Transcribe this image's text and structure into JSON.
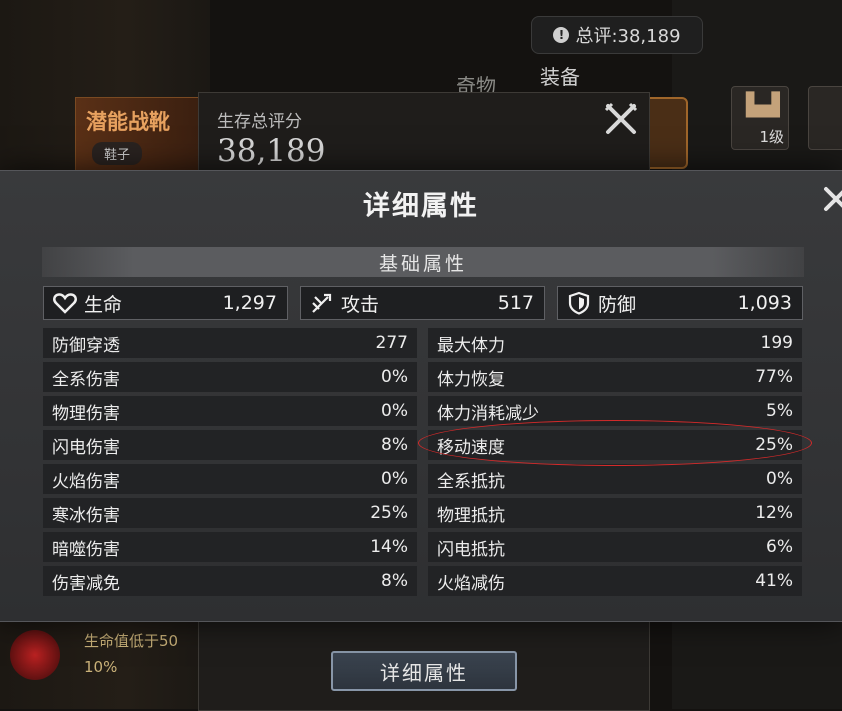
{
  "background": {
    "total_score_label": "总评:38,189",
    "tabs": {
      "curio": "奇物",
      "equipment": "装备"
    },
    "item": {
      "name": "潜能战靴",
      "type": "鞋子"
    },
    "slot_level": "1级",
    "panel": {
      "label": "生存总评分",
      "score": "38,189"
    },
    "bottom_text": [
      "生命值低于50",
      "10%"
    ],
    "bottom_button": "详细属性"
  },
  "modal": {
    "title": "详细属性",
    "section_title": "基础属性",
    "main_stats": [
      {
        "icon": "heart-icon",
        "label": "生命",
        "value": "1,297"
      },
      {
        "icon": "sword-icon",
        "label": "攻击",
        "value": "517"
      },
      {
        "icon": "shield-icon",
        "label": "防御",
        "value": "1,093"
      }
    ],
    "left_stats": [
      {
        "label": "防御穿透",
        "value": "277"
      },
      {
        "label": "全系伤害",
        "value": "0%"
      },
      {
        "label": "物理伤害",
        "value": "0%"
      },
      {
        "label": "闪电伤害",
        "value": "8%"
      },
      {
        "label": "火焰伤害",
        "value": "0%"
      },
      {
        "label": "寒冰伤害",
        "value": "25%"
      },
      {
        "label": "暗噬伤害",
        "value": "14%"
      },
      {
        "label": "伤害减免",
        "value": "8%"
      }
    ],
    "right_stats": [
      {
        "label": "最大体力",
        "value": "199"
      },
      {
        "label": "体力恢复",
        "value": "77%"
      },
      {
        "label": "体力消耗减少",
        "value": "5%"
      },
      {
        "label": "移动速度",
        "value": "25%"
      },
      {
        "label": "全系抵抗",
        "value": "0%"
      },
      {
        "label": "物理抵抗",
        "value": "12%"
      },
      {
        "label": "闪电抵抗",
        "value": "6%"
      },
      {
        "label": "火焰减伤",
        "value": "41%"
      }
    ]
  },
  "colors": {
    "highlight": "#d32a2a",
    "item_name": "#e7a15f"
  }
}
